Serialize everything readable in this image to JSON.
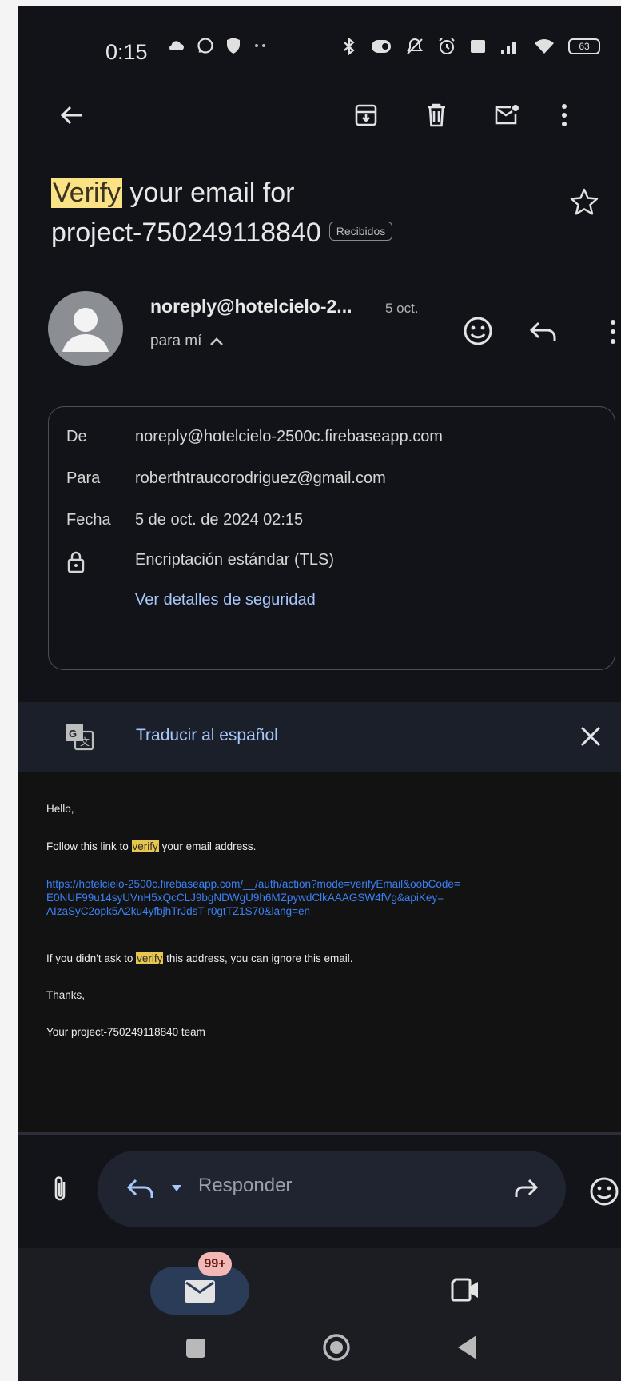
{
  "status_bar": {
    "time": "0:15",
    "battery": "63"
  },
  "email": {
    "subject_highlight": "Verify",
    "subject_line1_rest": " your email for",
    "subject_line2": "project-750249118840",
    "label": "Recibidos",
    "sender": "noreply@hotelcielo-2...",
    "date": "5 oct.",
    "to_me": "para mí",
    "details": {
      "from_label": "De",
      "from_value": "noreply@hotelcielo-2500c.firebaseapp.com",
      "to_label": "Para",
      "to_value": "roberthtraucorodriguez@gmail.com",
      "date_label": "Fecha",
      "date_value": "5 de oct. de 2024 02:15",
      "encryption": "Encriptación estándar (TLS)",
      "security_link": "Ver detalles de seguridad"
    }
  },
  "translate": {
    "label": "Traducir al español"
  },
  "body": {
    "hello": "Hello,",
    "follow_pre": "Follow this link to ",
    "verify_word": "verify",
    "follow_post": " your email address.",
    "link_line1": "https://hotelcielo-2500c.firebaseapp.com/__/auth/action?mode=verifyEmail&oobCode=",
    "link_line2": "E0NUF99u14syUVnH5xQcCLJ9bgNDWgU9h6MZpywdClkAAAGSW4fVg&apiKey=",
    "link_line3": "AIzaSyC2opk5A2ku4yfbjhTrJdsT-r0gtTZ1S70&lang=en",
    "ignore_pre": "If you didn't ask to ",
    "ignore_post": " this address, you can ignore this email.",
    "thanks": "Thanks,",
    "team": "Your project-750249118840 team"
  },
  "reply": {
    "placeholder": "Responder"
  },
  "bottom_nav": {
    "mail_badge": "99+"
  },
  "colors": {
    "background": "#111318",
    "highlight": "#fbe385",
    "link": "#3b82f6",
    "badge": "#f2b8b5"
  }
}
